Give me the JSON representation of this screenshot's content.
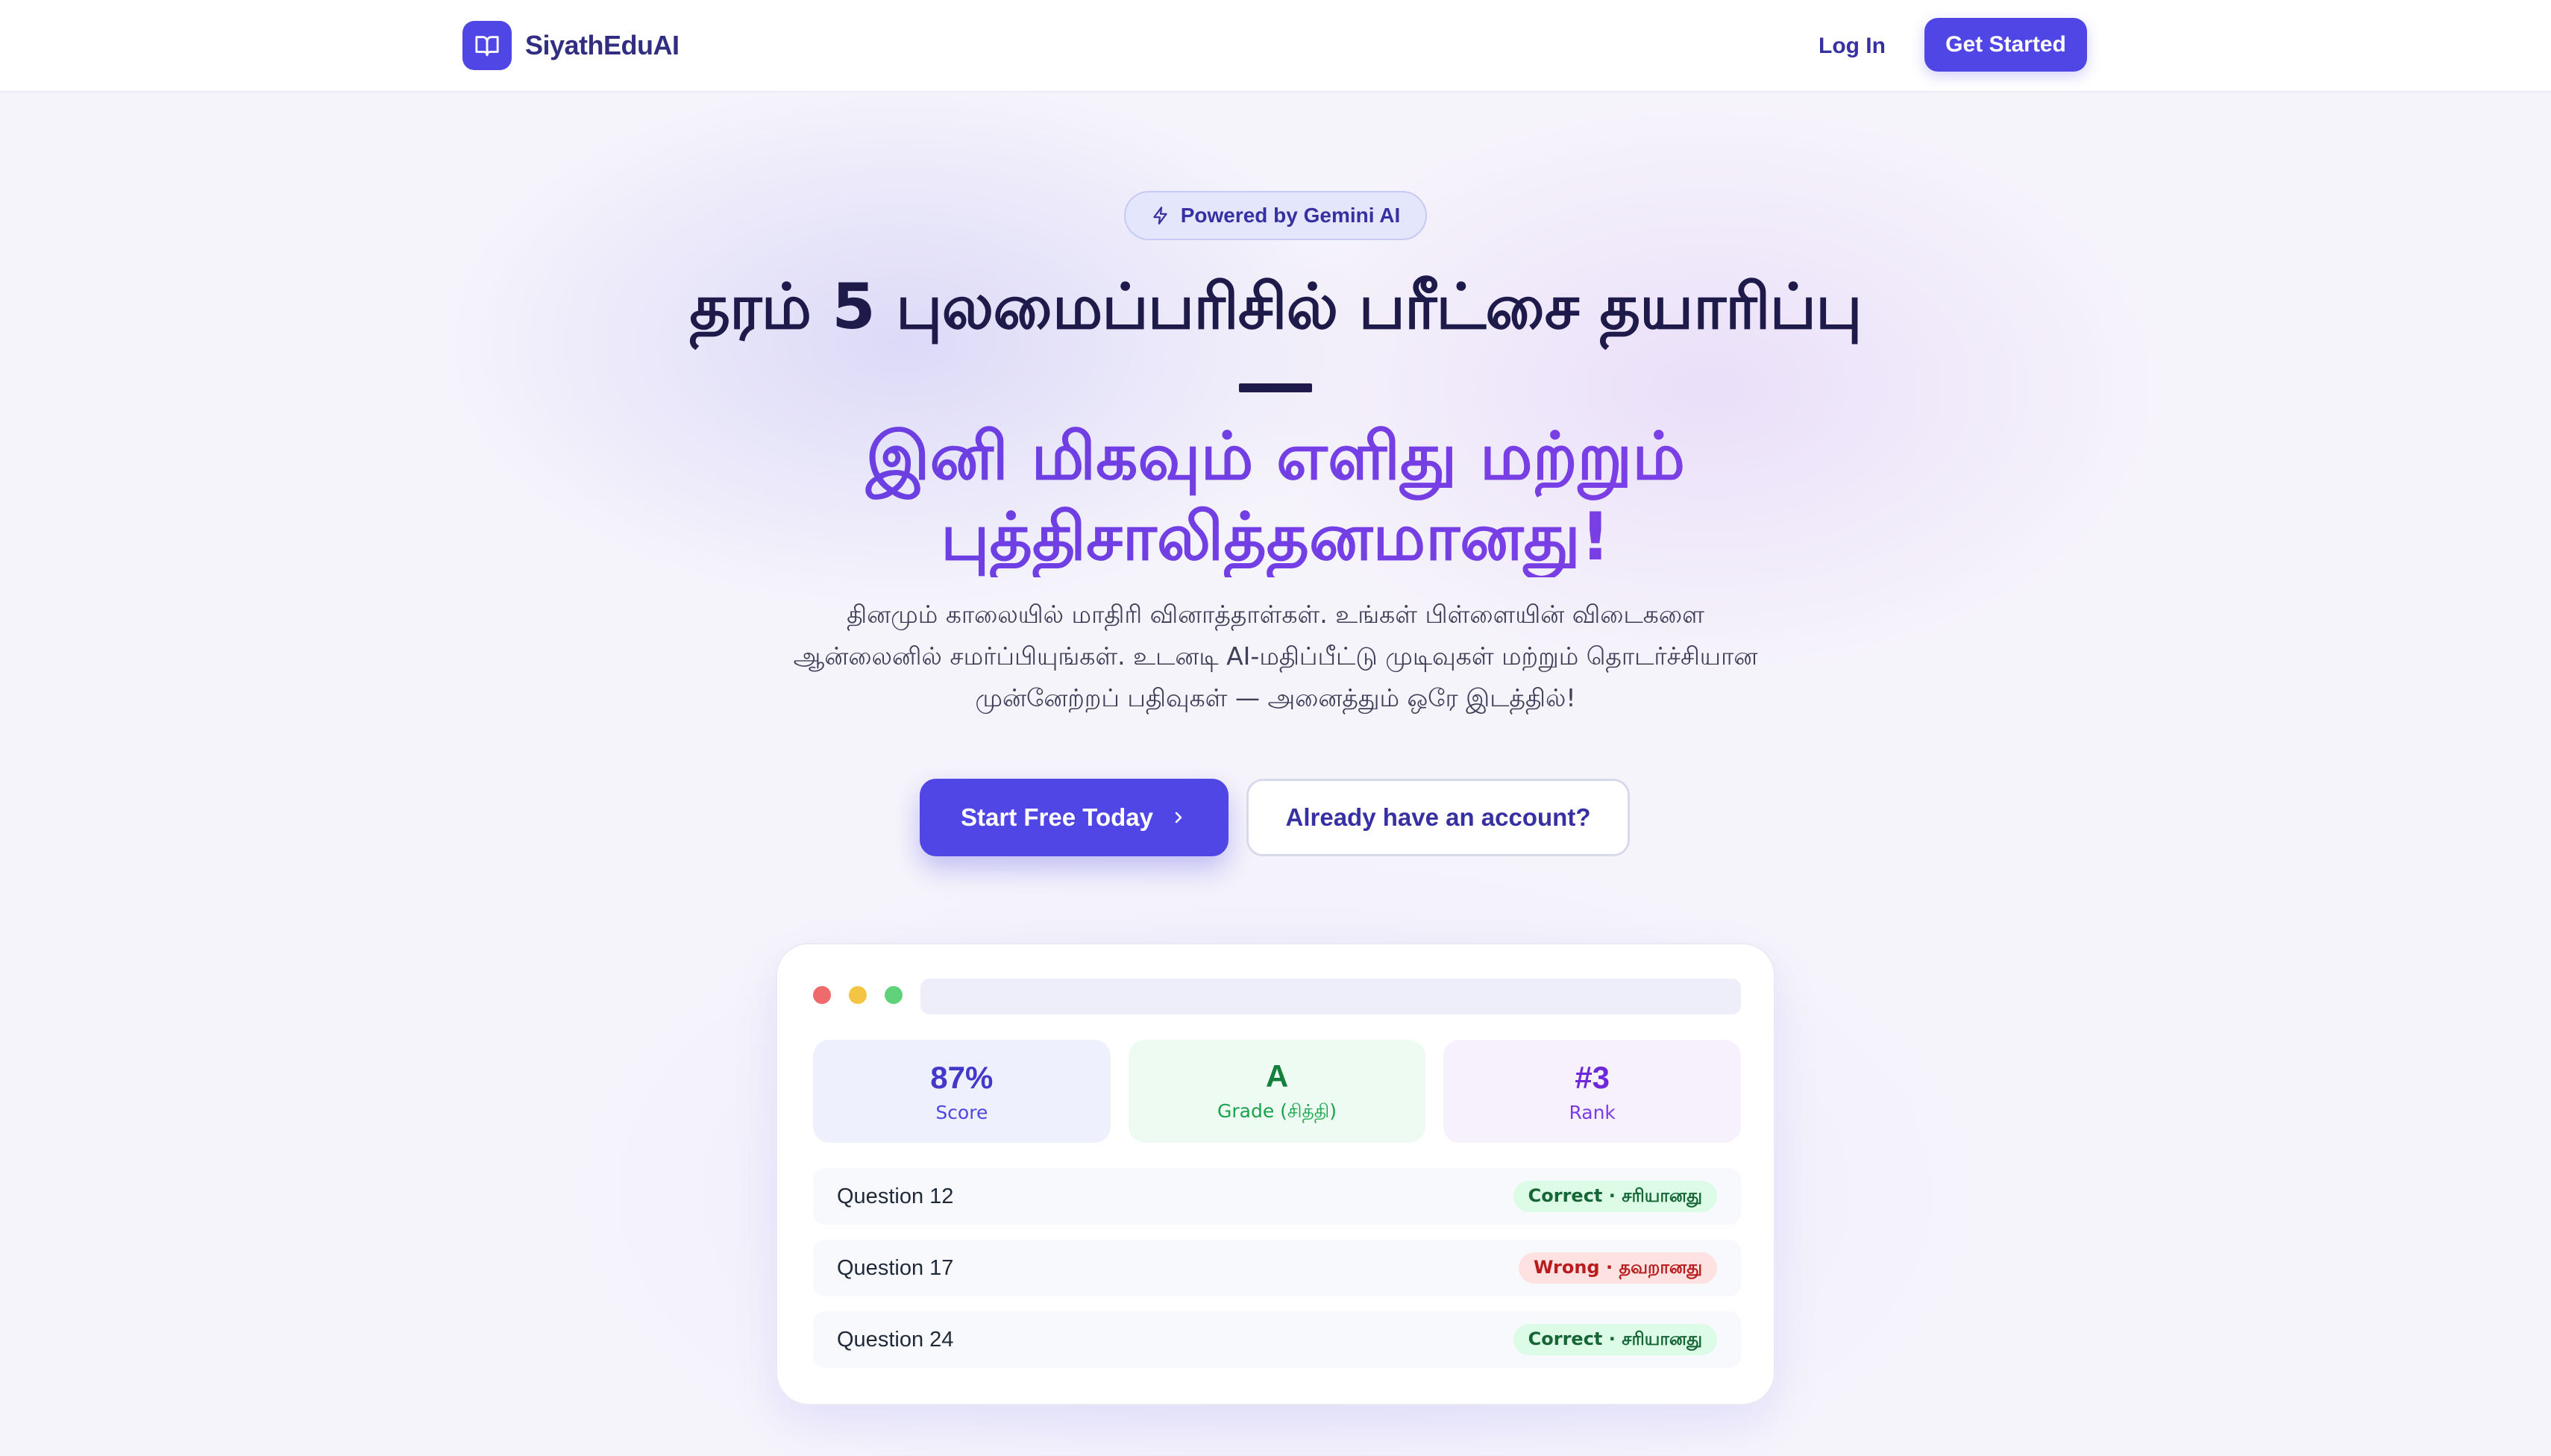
{
  "header": {
    "brand": "SiyathEduAI",
    "login_label": "Log In",
    "cta_label": "Get Started"
  },
  "hero": {
    "badge": "Powered by Gemini AI",
    "title": "தரம் 5 புலமைப்பரிசில் பரீட்சை தயாரிப்பு",
    "subtitle_line1": "இனி மிகவும் எளிது மற்றும்",
    "subtitle_line2": "புத்திசாலித்தனமானது!",
    "lead_line1": "தினமும் காலையில் மாதிரி வினாத்தாள்கள். உங்கள் பிள்ளையின் விடைகளை",
    "lead_line2": "ஆன்லைனில் சமர்ப்பியுங்கள். உடனடி AI-மதிப்பீட்டு முடிவுகள் மற்றும் தொடர்ச்சியான",
    "lead_line3": "முன்னேற்றப் பதிவுகள் — அனைத்தும் ஒரே இடத்தில்!",
    "primary_button": "Start Free Today",
    "secondary_button": "Already have an account?"
  },
  "preview": {
    "stats": [
      {
        "value": "87%",
        "label": "Score"
      },
      {
        "value": "A",
        "label": "Grade (சித்தி)"
      },
      {
        "value": "#3",
        "label": "Rank"
      }
    ],
    "rows": [
      {
        "label": "Question 12",
        "status": "Correct · சரியானது",
        "state": "correct"
      },
      {
        "label": "Question 17",
        "status": "Wrong · தவறானது",
        "state": "wrong"
      },
      {
        "label": "Question 24",
        "status": "Correct · சரியானது",
        "state": "correct"
      }
    ]
  },
  "colors": {
    "accent": "#4f46e5",
    "heading": "#1e1b4b",
    "subtitle": "#7c3aed",
    "correct": "#166534",
    "wrong": "#b91c1c"
  }
}
